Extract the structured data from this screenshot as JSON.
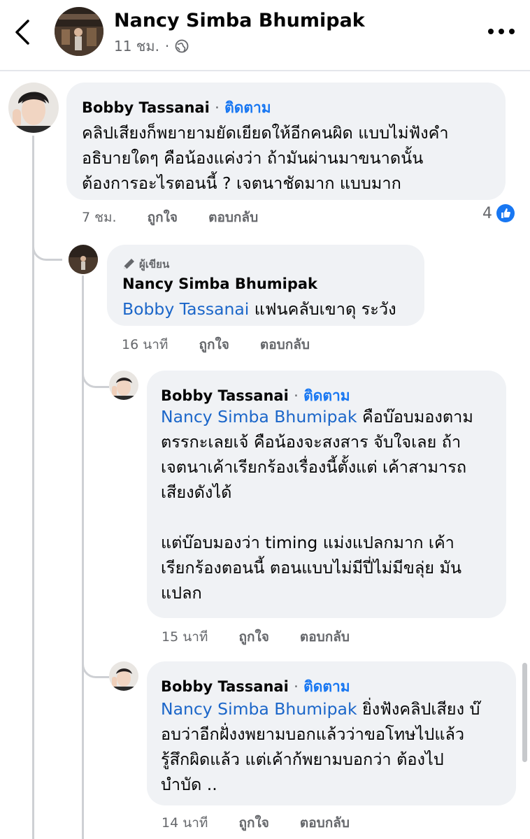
{
  "header": {
    "name": "Nancy Simba Bhumipak",
    "time": "11 ชม.",
    "separator": "·",
    "icons": {
      "back": "chevron-left-icon",
      "privacy": "globe-icon",
      "more": "more-dots-icon"
    }
  },
  "comments": [
    {
      "author": "Bobby Tassanai",
      "separator": "·",
      "follow": "ติดตาม",
      "lines": [
        "คลิปเสียงก็พยายามยัดเยียดให้อีกคนผิด แบบไม่ฟังคำ",
        "อธิบายใดๆ คือน้องแค่งว่า ถ้ามันผ่านมาขนาดนั้น",
        "ต้องการอะไรตอนนี้ ? เจตนาชัดมาก แบบมาก"
      ],
      "time": "7 ชม.",
      "like": "ถูกใจ",
      "reply": "ตอบกลับ",
      "reaction_count": "4"
    },
    {
      "author_tag": "ผู้เขียน",
      "author": "Nancy Simba Bhumipak",
      "mention": "Bobby Tassanai",
      "text": " แฟนคลับเขาดุ ระวัง",
      "time": "16 นาที",
      "like": "ถูกใจ",
      "reply": "ตอบกลับ"
    },
    {
      "author": "Bobby Tassanai",
      "separator": "·",
      "follow": "ติดตาม",
      "mention": "Nancy Simba Bhumipak",
      "first_line_rest": " คือบ๊อบมองตาม",
      "lines": [
        "ตรรกะเลยเจ้ คือน้องจะสงสาร จับใจเลย ถ้า",
        "เจตนาเค้าเรียกร้องเรื่องนี้ตั้งแต่ เค้าสามารถ",
        "เสียงดังได้",
        "",
        "แต่บ๊อบมองว่า timing แม่งแปลกมาก เค้า",
        "เรียกร้องตอนนี้ ตอนแบบไม่มีปี่ไม่มีขลุ่ย มัน",
        "แปลก"
      ],
      "time": "15 นาที",
      "like": "ถูกใจ",
      "reply": "ตอบกลับ"
    },
    {
      "author": "Bobby Tassanai",
      "separator": "·",
      "follow": "ติดตาม",
      "mention": "Nancy Simba Bhumipak",
      "first_line_rest": " ยิ่งฟังคลิปเสียง บ๊",
      "lines": [
        "อบว่าอีกฝั่งงพยามบอกแล้วว่าขอโทษไปแล้ว",
        "รู้สึกผิดแล้ว แต่เค้าก้พยามบอกว่า ต้องไป",
        "บำบัด .."
      ],
      "time": "14 นาที",
      "like": "ถูกใจ",
      "reply": "ตอบกลับ"
    }
  ],
  "colors": {
    "link": "#1877f2",
    "bubble": "#f0f2f5",
    "meta": "#65676b",
    "like_badge": "#1877f2"
  }
}
